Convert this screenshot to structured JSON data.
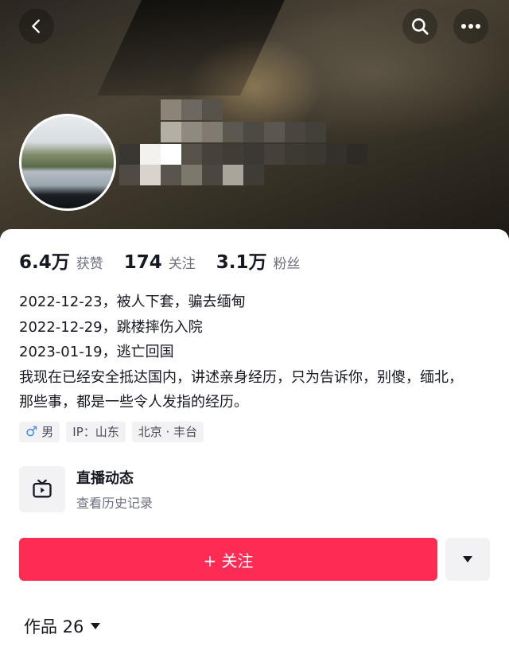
{
  "header": {
    "back_icon": "chevron-left-icon",
    "search_icon": "search-icon",
    "more_icon": "more-horizontal-icon"
  },
  "stats": [
    {
      "value": "6.4万",
      "label": "获赞"
    },
    {
      "value": "174",
      "label": "关注"
    },
    {
      "value": "3.1万",
      "label": "粉丝"
    }
  ],
  "bio": {
    "lines": [
      "2022-12-23，被人下套，骗去缅甸",
      "2022-12-29，跳楼摔伤入院",
      "2023-01-19，逃亡回国",
      "我现在已经安全抵达国内，讲述亲身经历，只为告诉你，别傻，缅北，那些事，都是一些令人发指的经历。"
    ]
  },
  "tags": {
    "gender_symbol": "♂",
    "gender": "男",
    "ip": "IP：山东",
    "location": "北京 · 丰台"
  },
  "live": {
    "icon": "tv-icon",
    "title": "直播动态",
    "subtitle": "查看历史记录"
  },
  "follow_button": {
    "label": "+ 关注"
  },
  "dropdown_icon": "caret-down-icon",
  "works": {
    "label": "作品 26"
  },
  "colors": {
    "accent": "#fe2c55",
    "text": "#161823",
    "muted": "#6e7080",
    "tag_bg": "#f2f2f4",
    "gender_icon": "#3a8ee6"
  }
}
